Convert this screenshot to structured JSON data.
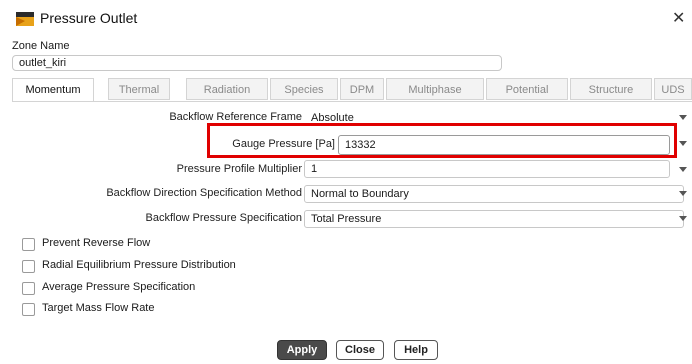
{
  "window": {
    "title": "Pressure Outlet",
    "close_glyph": "✕"
  },
  "zone": {
    "label": "Zone Name",
    "value": "outlet_kiri"
  },
  "tabs": [
    {
      "label": "Momentum",
      "active": true
    },
    {
      "label": "Thermal",
      "active": false
    },
    {
      "label": "Radiation",
      "active": false
    },
    {
      "label": "Species",
      "active": false
    },
    {
      "label": "DPM",
      "active": false
    },
    {
      "label": "Multiphase",
      "active": false
    },
    {
      "label": "Potential",
      "active": false
    },
    {
      "label": "Structure",
      "active": false
    },
    {
      "label": "UDS",
      "active": false
    }
  ],
  "momentum": {
    "backflow_reference_frame": {
      "label": "Backflow Reference Frame",
      "value": "Absolute"
    },
    "gauge_pressure": {
      "label": "Gauge Pressure [Pa]",
      "value": "13332"
    },
    "pressure_profile_multiplier": {
      "label": "Pressure Profile Multiplier",
      "value": "1"
    },
    "backflow_direction_method": {
      "label": "Backflow Direction Specification Method",
      "value": "Normal to Boundary"
    },
    "backflow_pressure_spec": {
      "label": "Backflow Pressure Specification",
      "value": "Total Pressure"
    }
  },
  "checkboxes": [
    {
      "label": "Prevent Reverse Flow",
      "checked": false
    },
    {
      "label": "Radial Equilibrium Pressure Distribution",
      "checked": false
    },
    {
      "label": "Average Pressure Specification",
      "checked": false
    },
    {
      "label": "Target Mass Flow Rate",
      "checked": false
    }
  ],
  "buttons": {
    "apply": "Apply",
    "close": "Close",
    "help": "Help"
  },
  "icons": {
    "app": "fluent-boundary-icon",
    "close": "close-icon",
    "dropdown": "chevron-down-icon"
  },
  "colors": {
    "highlight": "#e00000",
    "apply_bg": "#4a4a4a",
    "tab_inactive_bg": "#f3f3f3"
  }
}
